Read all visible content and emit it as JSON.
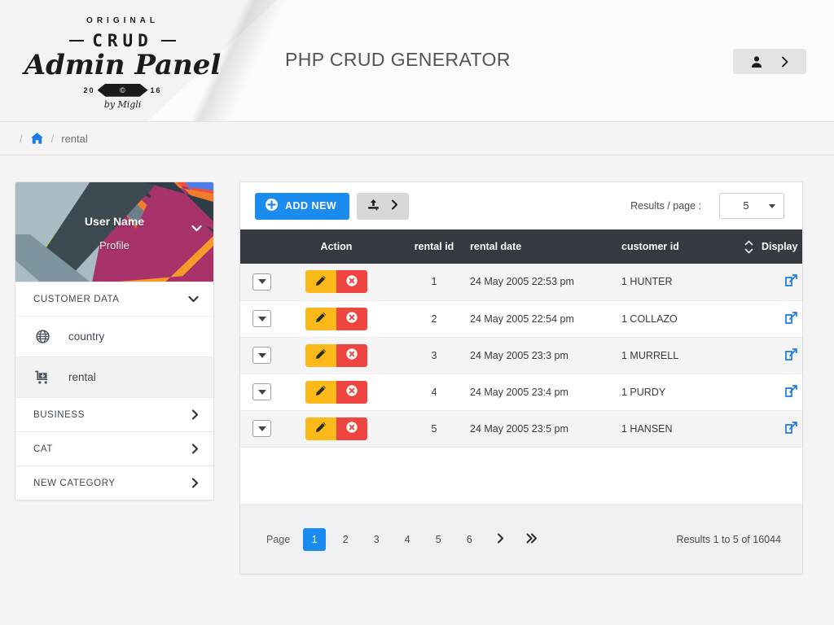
{
  "brand": {
    "original": "ORIGINAL",
    "crud": "CRUD",
    "admin_panel": "Admin Panel",
    "year_left": "20",
    "year_right": "16",
    "by": "by Migli"
  },
  "header": {
    "title": "PHP CRUD GENERATOR",
    "user_icon": "user-icon",
    "user_chevron_icon": "chevron-right-icon"
  },
  "breadcrumb": {
    "sep1": "/",
    "home_icon": "home-icon",
    "sep2": "/",
    "current": "rental"
  },
  "sidebar": {
    "profile": {
      "name": "User Name",
      "subtitle": "Profile",
      "caret_icon": "chevron-down-icon"
    },
    "sections": [
      {
        "label": "CUSTOMER DATA",
        "expanded": true,
        "icon": "chevron-down-icon"
      },
      {
        "label": "BUSINESS",
        "expanded": false,
        "icon": "chevron-right-icon"
      },
      {
        "label": "CAT",
        "expanded": false,
        "icon": "chevron-right-icon"
      },
      {
        "label": "NEW CATEGORY",
        "expanded": false,
        "icon": "chevron-right-icon"
      }
    ],
    "items": [
      {
        "label": "country",
        "icon": "globe-icon",
        "active": false
      },
      {
        "label": "rental",
        "icon": "shopping-cart-icon",
        "active": true
      }
    ]
  },
  "toolbar": {
    "add_new_label": "ADD NEW",
    "add_new_icon": "plus-circle-icon",
    "export_icon": "upload-icon",
    "export_chevron_icon": "chevron-right-icon",
    "results_per_page_label": "Results / page :",
    "results_per_page_value": "5"
  },
  "table": {
    "columns": [
      "",
      "Action",
      "rental id",
      "rental date",
      "customer id",
      "",
      "Display"
    ],
    "sort_icon": "sort-updown-icon",
    "row_handle_icon": "caret-down-icon",
    "edit_icon": "pencil-icon",
    "delete_icon": "delete-circle-icon",
    "display_icon": "external-link-icon",
    "rows": [
      {
        "rental_id": "1",
        "rental_date": "24 May 2005 22:53 pm",
        "customer_id": "1 HUNTER"
      },
      {
        "rental_id": "2",
        "rental_date": "24 May 2005 22:54 pm",
        "customer_id": "1 COLLAZO"
      },
      {
        "rental_id": "3",
        "rental_date": "24 May 2005 23:3 pm",
        "customer_id": "1 MURRELL"
      },
      {
        "rental_id": "4",
        "rental_date": "24 May 2005 23:4 pm",
        "customer_id": "1 PURDY"
      },
      {
        "rental_id": "5",
        "rental_date": "24 May 2005 23:5 pm",
        "customer_id": "1 HANSEN"
      }
    ]
  },
  "pagination": {
    "page_label": "Page",
    "pages": [
      "1",
      "2",
      "3",
      "4",
      "5",
      "6"
    ],
    "active_page": "1",
    "next_icon": "chevron-right-icon",
    "last_icon": "double-chevron-right-icon",
    "results_summary": "Results 1 to 5 of 16044"
  },
  "colors": {
    "accent_blue": "#1a8cf0",
    "link_blue": "#1a7ae8",
    "table_header": "#343a40",
    "edit_amber": "#fcb91a",
    "delete_red": "#ee4540",
    "page_bg": "#f4f4f4"
  }
}
